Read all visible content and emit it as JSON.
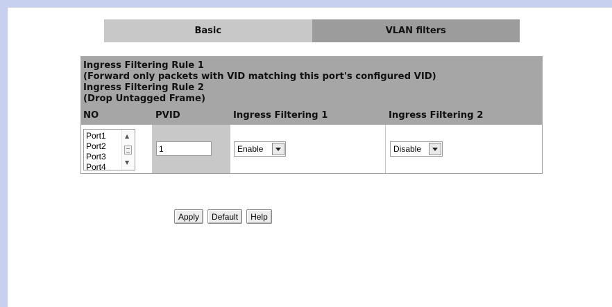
{
  "tabs": {
    "basic": "Basic",
    "vlan_filters": "VLAN filters"
  },
  "rules": {
    "line1": "Ingress Filtering Rule 1",
    "line2": "(Forward only packets with VID matching this port's configured VID)",
    "line3": "Ingress Filtering Rule 2",
    "line4": "(Drop Untagged Frame)"
  },
  "table": {
    "headers": {
      "no": "NO",
      "pvid": "PVID",
      "ingress1": "Ingress Filtering 1",
      "ingress2": "Ingress Filtering 2"
    },
    "ports": [
      "Port1",
      "Port2",
      "Port3",
      "Port4"
    ],
    "pvid_value": "1",
    "ingress1_value": "Enable",
    "ingress2_value": "Disable"
  },
  "buttons": {
    "apply": "Apply",
    "default": "Default",
    "help": "Help"
  },
  "colors": {
    "frame": "#c8d0f0",
    "header_gray": "#a6a6a6",
    "tab_basic": "#c8c8c8",
    "tab_vlan": "#9c9c9c"
  }
}
